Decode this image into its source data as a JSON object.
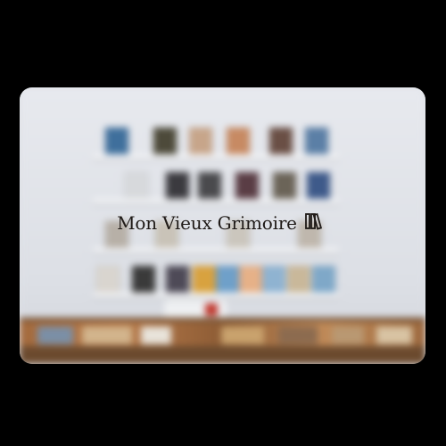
{
  "brand": {
    "name": "Mon Vieux Grimoire",
    "logo_icon": "books-icon"
  },
  "colors": {
    "page_background": "#000000",
    "wall": "#dfe2e7",
    "counter_wood": "#a36a3d",
    "logo_text": "#1f1a17"
  }
}
